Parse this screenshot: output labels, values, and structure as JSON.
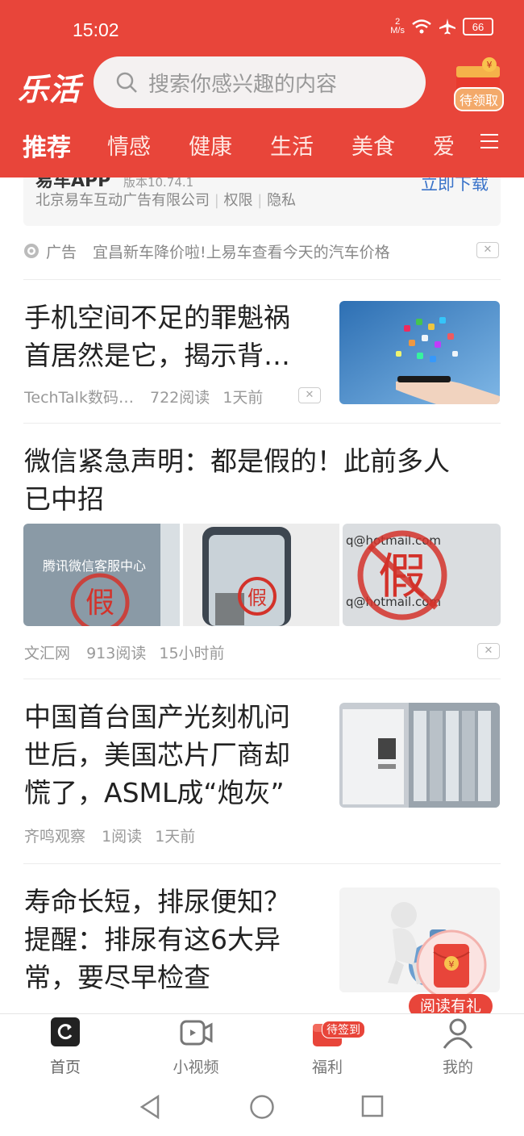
{
  "status_bar": {
    "time": "15:02",
    "net_speed_value": "2",
    "net_speed_unit": "M/s",
    "battery": "66"
  },
  "header": {
    "logo": "乐活",
    "search_placeholder": "搜索你感兴趣的内容",
    "redpack_label": "待领取",
    "tabs": [
      "推荐",
      "情感",
      "健康",
      "生活",
      "美食",
      "爱"
    ]
  },
  "ad": {
    "title_cut": "易车APP",
    "version_cut": "版本10.74.1",
    "company": "北京易车互动广告有限公司",
    "links": [
      "权限",
      "隐私"
    ],
    "download": "立即下载",
    "ad_tag": "广告",
    "ad_text": "宜昌新车降价啦!上易车查看今天的汽车价格"
  },
  "articles": [
    {
      "title_line1": "手机空间不足的罪魁祸",
      "title_line2": "首居然是它，揭示背…",
      "source": "TechTalk数码…",
      "reads": "722阅读",
      "time": "1天前"
    },
    {
      "title_line1": "微信紧急声明：都是假的！此前多人",
      "title_line2": "已中招",
      "source": "文汇网",
      "reads": "913阅读",
      "time": "15小时前",
      "img_caption": "腾讯微信客服中心",
      "stamp": "假",
      "email_text": "q@hotmail.com"
    },
    {
      "title_line1": "中国首台国产光刻机问",
      "title_line2": "世后，美国芯片厂商却",
      "title_line3": "慌了，ASML成“炮灰”",
      "source": "齐鸣观察",
      "reads": "1阅读",
      "time": "1天前"
    },
    {
      "title_line1": "寿命长短，排尿便知？",
      "title_line2": "提醒：排尿有这6大异",
      "title_line3": "常，要尽早检查"
    }
  ],
  "floating_badge": {
    "label": "阅读有礼",
    "symbol": "¥"
  },
  "bottom_nav": [
    {
      "label": "首页"
    },
    {
      "label": "小视频"
    },
    {
      "label": "福利",
      "badge": "待签到"
    },
    {
      "label": "我的"
    }
  ],
  "colors": {
    "brand_red": "#e8453a",
    "link_blue": "#3a73c9"
  }
}
